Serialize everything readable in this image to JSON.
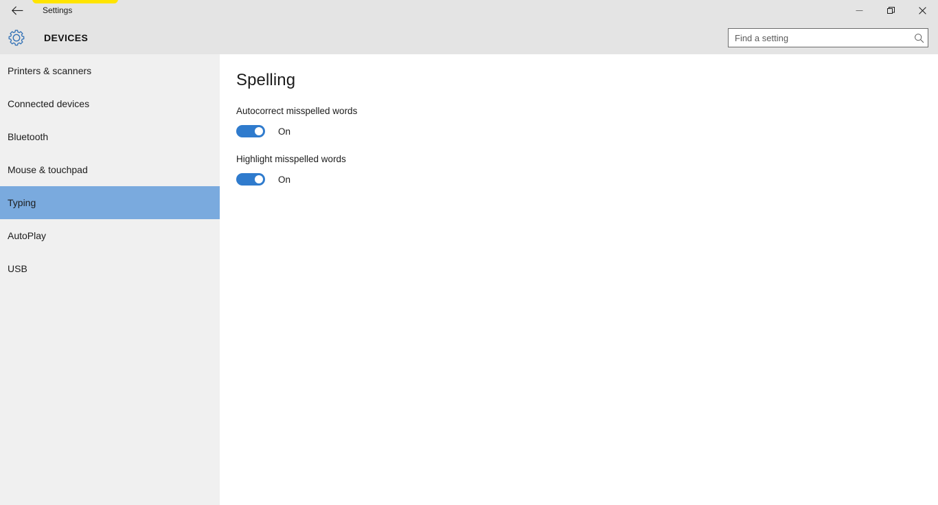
{
  "window": {
    "title": "Settings",
    "back_icon": "back-arrow-icon",
    "controls": {
      "minimize": "minimize-icon",
      "restore": "restore-icon",
      "close": "close-icon"
    }
  },
  "header": {
    "icon": "gear-icon",
    "title": "DEVICES",
    "search": {
      "placeholder": "Find a setting",
      "value": "",
      "icon": "search-icon"
    }
  },
  "sidebar": {
    "items": [
      {
        "label": "Printers & scanners",
        "selected": false
      },
      {
        "label": "Connected devices",
        "selected": false
      },
      {
        "label": "Bluetooth",
        "selected": false
      },
      {
        "label": "Mouse & touchpad",
        "selected": false
      },
      {
        "label": "Typing",
        "selected": true
      },
      {
        "label": "AutoPlay",
        "selected": false
      },
      {
        "label": "USB",
        "selected": false
      }
    ]
  },
  "main": {
    "title": "Spelling",
    "settings": [
      {
        "label": "Autocorrect misspelled words",
        "state": "On",
        "on": true
      },
      {
        "label": "Highlight misspelled words",
        "state": "On",
        "on": true
      }
    ]
  },
  "overlay": {
    "highlight": "yellow-highlight-marker"
  },
  "colors": {
    "accent": "#2f7bcd",
    "selection": "#7aaade",
    "chrome": "#e4e4e4",
    "sidebar": "#f0f0f0",
    "highlight": "#ffe400"
  }
}
